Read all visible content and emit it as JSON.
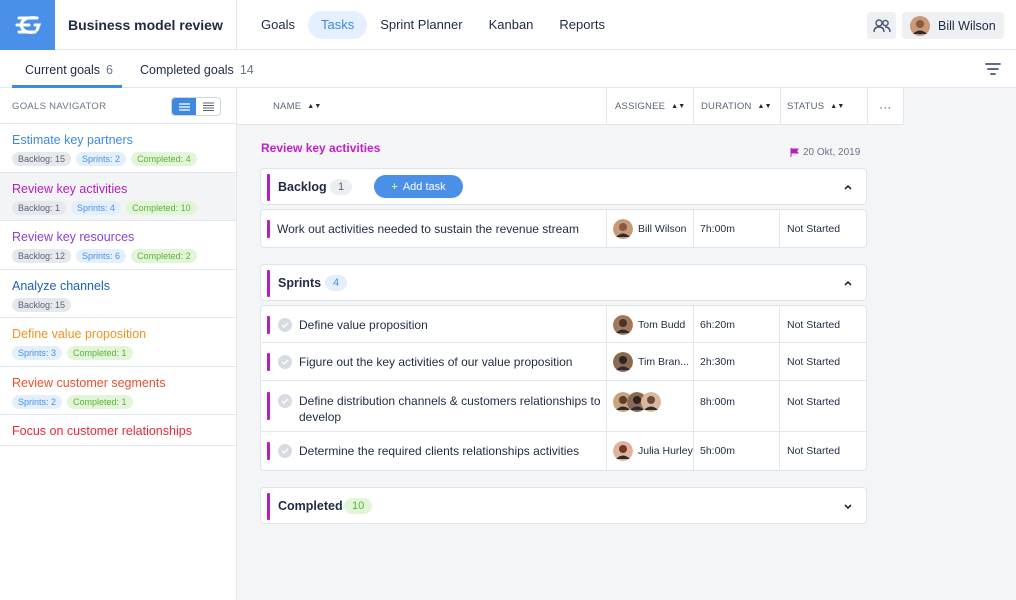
{
  "app": {
    "title": "Business model review"
  },
  "nav": {
    "items": [
      "Goals",
      "Tasks",
      "Sprint Planner",
      "Kanban",
      "Reports"
    ],
    "active": "Tasks"
  },
  "user": {
    "name": "Bill Wilson"
  },
  "subtabs": [
    {
      "label": "Current goals",
      "count": "6"
    },
    {
      "label": "Completed goals",
      "count": "14"
    }
  ],
  "sidebar": {
    "header": "GOALS NAVIGATOR",
    "goals": [
      {
        "title": "Estimate key partners",
        "color": "#3f8ae0",
        "badges": [
          {
            "type": "backlog",
            "text": "Backlog: 15"
          },
          {
            "type": "sprints",
            "text": "Sprints: 2"
          },
          {
            "type": "completed",
            "text": "Completed: 4"
          }
        ]
      },
      {
        "title": "Review key activities",
        "color": "#b61ec0",
        "badges": [
          {
            "type": "backlog",
            "text": "Backlog: 1"
          },
          {
            "type": "sprints",
            "text": "Sprints: 4"
          },
          {
            "type": "completed",
            "text": "Completed: 10"
          }
        ]
      },
      {
        "title": "Review key resources",
        "color": "#8a3fd8",
        "badges": [
          {
            "type": "backlog",
            "text": "Backlog: 12"
          },
          {
            "type": "sprints",
            "text": "Sprints: 6"
          },
          {
            "type": "completed",
            "text": "Completed: 2"
          }
        ]
      },
      {
        "title": "Analyze channels",
        "color": "#1f5fb8",
        "badges": [
          {
            "type": "backlog",
            "text": "Backlog: 15"
          }
        ]
      },
      {
        "title": "Define value proposition",
        "color": "#f0921e",
        "badges": [
          {
            "type": "sprints",
            "text": "Sprints: 3"
          },
          {
            "type": "completed",
            "text": "Completed: 1"
          }
        ]
      },
      {
        "title": "Review customer segments",
        "color": "#e8502d",
        "badges": [
          {
            "type": "sprints",
            "text": "Sprints: 2"
          },
          {
            "type": "completed",
            "text": "Completed: 1"
          }
        ]
      },
      {
        "title": "Focus on customer relationships",
        "color": "#e8283a",
        "badges": []
      }
    ]
  },
  "columns": {
    "name": "NAME",
    "assignee": "ASSIGNEE",
    "duration": "DURATION",
    "status": "STATUS",
    "more": "···"
  },
  "goal": {
    "title": "Review key activities",
    "date": "20 Okt, 2019"
  },
  "backlog": {
    "title": "Backlog",
    "count": "1",
    "add_task": "Add task",
    "tasks": [
      {
        "name": "Work out activities needed to sustain the revenue stream",
        "assignee": "Bill Wilson",
        "duration": "7h:00m",
        "status": "Not Started"
      }
    ]
  },
  "sprints": {
    "title": "Sprints",
    "count": "4",
    "tasks": [
      {
        "name": "Define value proposition",
        "assignee": "Tom Budd",
        "duration": "6h:20m",
        "status": "Not Started"
      },
      {
        "name": "Figure out the key activities of our value proposition",
        "assignee": "Tim Bran...",
        "duration": "2h:30m",
        "status": "Not Started"
      },
      {
        "name": "Define distribution channels & customers relationships to develop",
        "assignee": "",
        "duration": "8h:00m",
        "status": "Not Started"
      },
      {
        "name": "Determine the required clients relationships activities",
        "assignee": "Julia Hurley",
        "duration": "5h:00m",
        "status": "Not Started"
      }
    ]
  },
  "completed": {
    "title": "Completed",
    "count": "10"
  },
  "colors": {
    "accent": "#3f8ae0",
    "goal": "#b61ec0"
  }
}
